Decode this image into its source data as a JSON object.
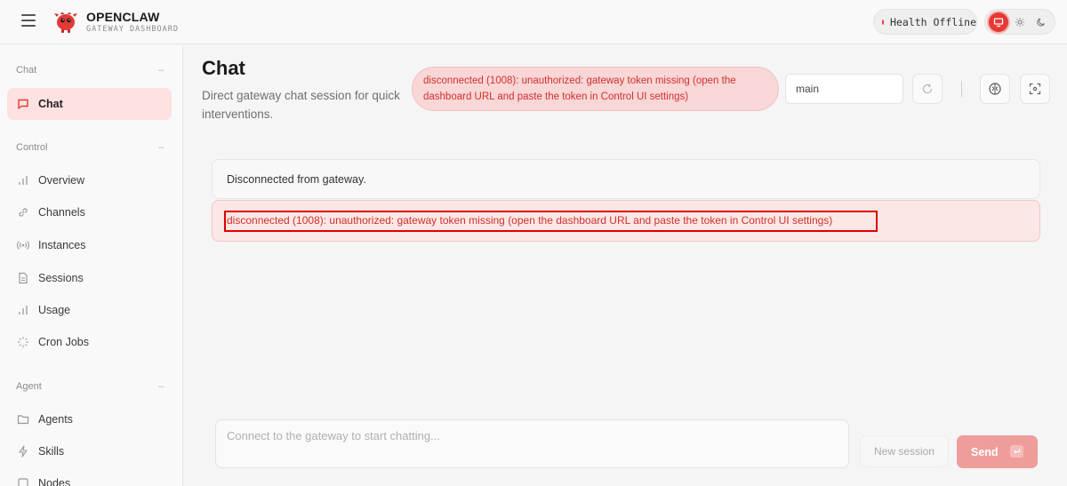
{
  "app": {
    "brand_title": "OPENCLAW",
    "brand_subtitle": "GATEWAY DASHBOARD",
    "health_label": "Health",
    "health_status": "Offline",
    "accent_color": "#e53935"
  },
  "sidebar": {
    "groups": [
      {
        "label": "Chat",
        "collapse": "–",
        "items": [
          {
            "label": "Chat",
            "icon": "message-square-icon",
            "active": true
          }
        ]
      },
      {
        "label": "Control",
        "collapse": "–",
        "items": [
          {
            "label": "Overview",
            "icon": "bar-chart-icon"
          },
          {
            "label": "Channels",
            "icon": "link-icon"
          },
          {
            "label": "Instances",
            "icon": "radio-icon"
          },
          {
            "label": "Sessions",
            "icon": "file-text-icon"
          },
          {
            "label": "Usage",
            "icon": "bar-chart-icon"
          },
          {
            "label": "Cron Jobs",
            "icon": "loader-icon"
          }
        ]
      },
      {
        "label": "Agent",
        "collapse": "–",
        "items": [
          {
            "label": "Agents",
            "icon": "folder-icon"
          },
          {
            "label": "Skills",
            "icon": "zap-icon"
          },
          {
            "label": "Nodes",
            "icon": "square-icon"
          }
        ]
      }
    ]
  },
  "main": {
    "title": "Chat",
    "subtitle": "Direct gateway chat session for quick interventions.",
    "error_banner": "disconnected (1008): unauthorized: gateway token missing (open the dashboard URL and paste the token in Control UI settings)",
    "session_key": "main",
    "messages": {
      "status": "Disconnected from gateway.",
      "error": "disconnected (1008): unauthorized: gateway token missing (open the dashboard URL and paste the token in Control UI settings)"
    },
    "composer": {
      "placeholder": "Connect to the gateway to start chatting...",
      "new_session_label": "New session",
      "send_label": "Send"
    }
  }
}
